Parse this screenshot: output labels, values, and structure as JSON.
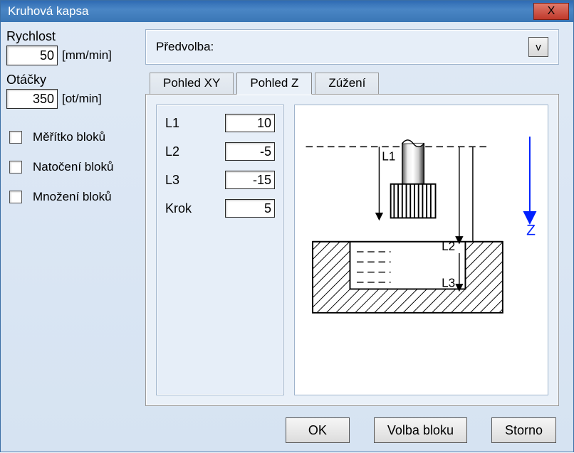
{
  "window": {
    "title": "Kruhová kapsa",
    "close": "X"
  },
  "left": {
    "rychlost_label": "Rychlost",
    "rychlost_value": "50",
    "rychlost_unit": "[mm/min]",
    "otacky_label": "Otáčky",
    "otacky_value": "350",
    "otacky_unit": "[ot/min]",
    "chk_meritko": "Měřítko bloků",
    "chk_natoceni": "Natočení bloků",
    "chk_mnozeni": "Množení bloků"
  },
  "preset": {
    "label": "Předvolba:",
    "button": "v"
  },
  "tabs": {
    "xy": "Pohled XY",
    "z": "Pohled Z",
    "zuzeni": "Zúžení"
  },
  "params": {
    "l1_label": "L1",
    "l1_value": "10",
    "l2_label": "L2",
    "l2_value": "-5",
    "l3_label": "L3",
    "l3_value": "-15",
    "krok_label": "Krok",
    "krok_value": "5"
  },
  "diagram": {
    "l1": "L1",
    "l2": "L2",
    "l3": "L3",
    "z": "Z"
  },
  "buttons": {
    "ok": "OK",
    "volba": "Volba bloku",
    "storno": "Storno"
  }
}
